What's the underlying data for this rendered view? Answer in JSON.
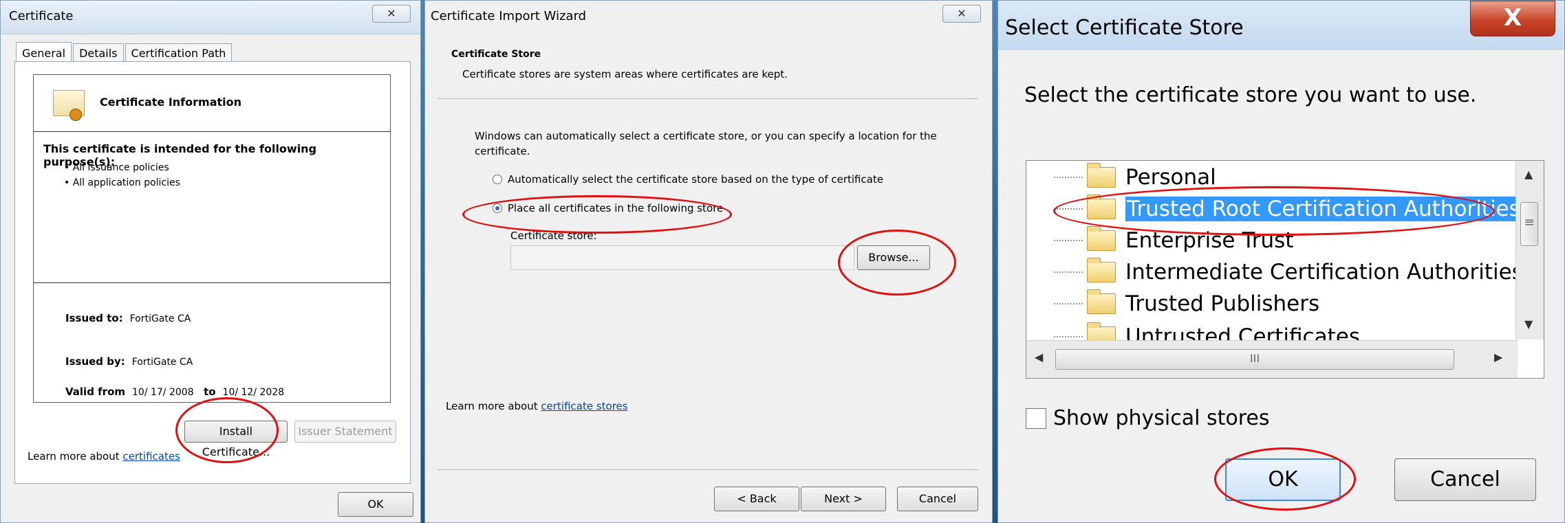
{
  "certificate": {
    "title": "Certificate",
    "close_glyph": "✕",
    "tabs": [
      "General",
      "Details",
      "Certification Path"
    ],
    "info_title": "Certificate Information",
    "purpose_heading": "This certificate is intended for the following purpose(s):",
    "purposes": [
      "• All issuance policies",
      "• All application policies"
    ],
    "issued_to_label": "Issued to:",
    "issued_to": "FortiGate CA",
    "issued_by_label": "Issued by:",
    "issued_by": "FortiGate CA",
    "valid_from_label": "Valid from",
    "valid_from": "10/ 17/ 2008",
    "valid_to_label": "to",
    "valid_to": "10/ 12/ 2028",
    "install_button": "Install Certificate...",
    "issuer_button": "Issuer Statement",
    "learn_prefix": "Learn more about ",
    "learn_link": "certificates",
    "ok_button": "OK"
  },
  "wizard": {
    "title": "Certificate Import Wizard",
    "close_glyph": "✕",
    "heading": "Certificate Store",
    "subheading": "Certificate stores are system areas where certificates are kept.",
    "paragraph": "Windows can automatically select a certificate store, or you can specify a location for the certificate.",
    "radio_auto": "Automatically select the certificate store based on the type of certificate",
    "radio_place": "Place all certificates in the following store",
    "store_label": "Certificate store:",
    "store_value": "",
    "browse_button": "Browse...",
    "learn_prefix": "Learn more about ",
    "learn_link": "certificate stores",
    "back_button": "< Back",
    "next_button": "Next >",
    "cancel_button": "Cancel"
  },
  "store_dialog": {
    "title": "Select Certificate Store",
    "close_glyph": "X",
    "prompt": "Select the certificate store you want to use.",
    "stores": [
      "Personal",
      "Trusted Root Certification Authorities",
      "Enterprise Trust",
      "Intermediate Certification Authorities",
      "Trusted Publishers",
      "Untrusted Certificates"
    ],
    "selected_store": "Trusted Root Certification Authorities",
    "show_physical_label": "Show physical stores",
    "ok_button": "OK",
    "cancel_button": "Cancel",
    "scroll_up": "▲",
    "scroll_down": "▼",
    "scroll_left": "◀",
    "scroll_right": "▶",
    "thumb_grip": "≡",
    "hthumb_grip": "III"
  },
  "colors": {
    "highlight_ring": "#e01010",
    "selection": "#3399ff",
    "link": "#0645ad"
  }
}
